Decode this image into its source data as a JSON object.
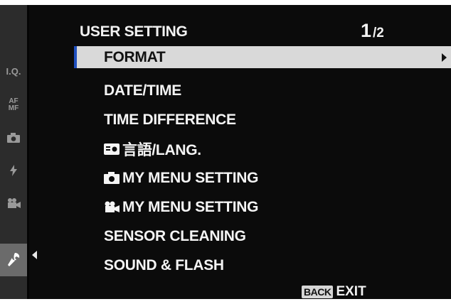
{
  "header": {
    "title": "USER SETTING",
    "page_current": "1",
    "page_total": "/2"
  },
  "tabs": [
    {
      "label": "I.Q.",
      "icon": "image-quality-icon",
      "active": false
    },
    {
      "label": "AF MF",
      "icon": "focus-icon",
      "active": false
    },
    {
      "label": "",
      "icon": "camera-icon",
      "active": false
    },
    {
      "label": "",
      "icon": "flash-icon",
      "active": false
    },
    {
      "label": "",
      "icon": "movie-icon",
      "active": false
    },
    {
      "label": "",
      "icon": "wrench-icon",
      "active": true
    }
  ],
  "menu": {
    "items": [
      {
        "label": "FORMAT",
        "selected": true,
        "has_submenu": true
      },
      {
        "label": "DATE/TIME"
      },
      {
        "label": "TIME DIFFERENCE"
      },
      {
        "label": "言語/LANG.",
        "icon": "language-icon"
      },
      {
        "label": "MY MENU SETTING",
        "icon": "camera-icon"
      },
      {
        "label": "MY MENU SETTING",
        "icon": "movie-camera-icon"
      },
      {
        "label": "SENSOR CLEANING"
      },
      {
        "label": "SOUND & FLASH"
      }
    ]
  },
  "footer": {
    "back_label": "BACK",
    "exit_label": "EXIT"
  },
  "colors": {
    "background": "#0b0b0b",
    "selected_bg": "#d9d9d9",
    "accent": "#1f4fbf",
    "tab_strip": "#2c2c2c"
  }
}
